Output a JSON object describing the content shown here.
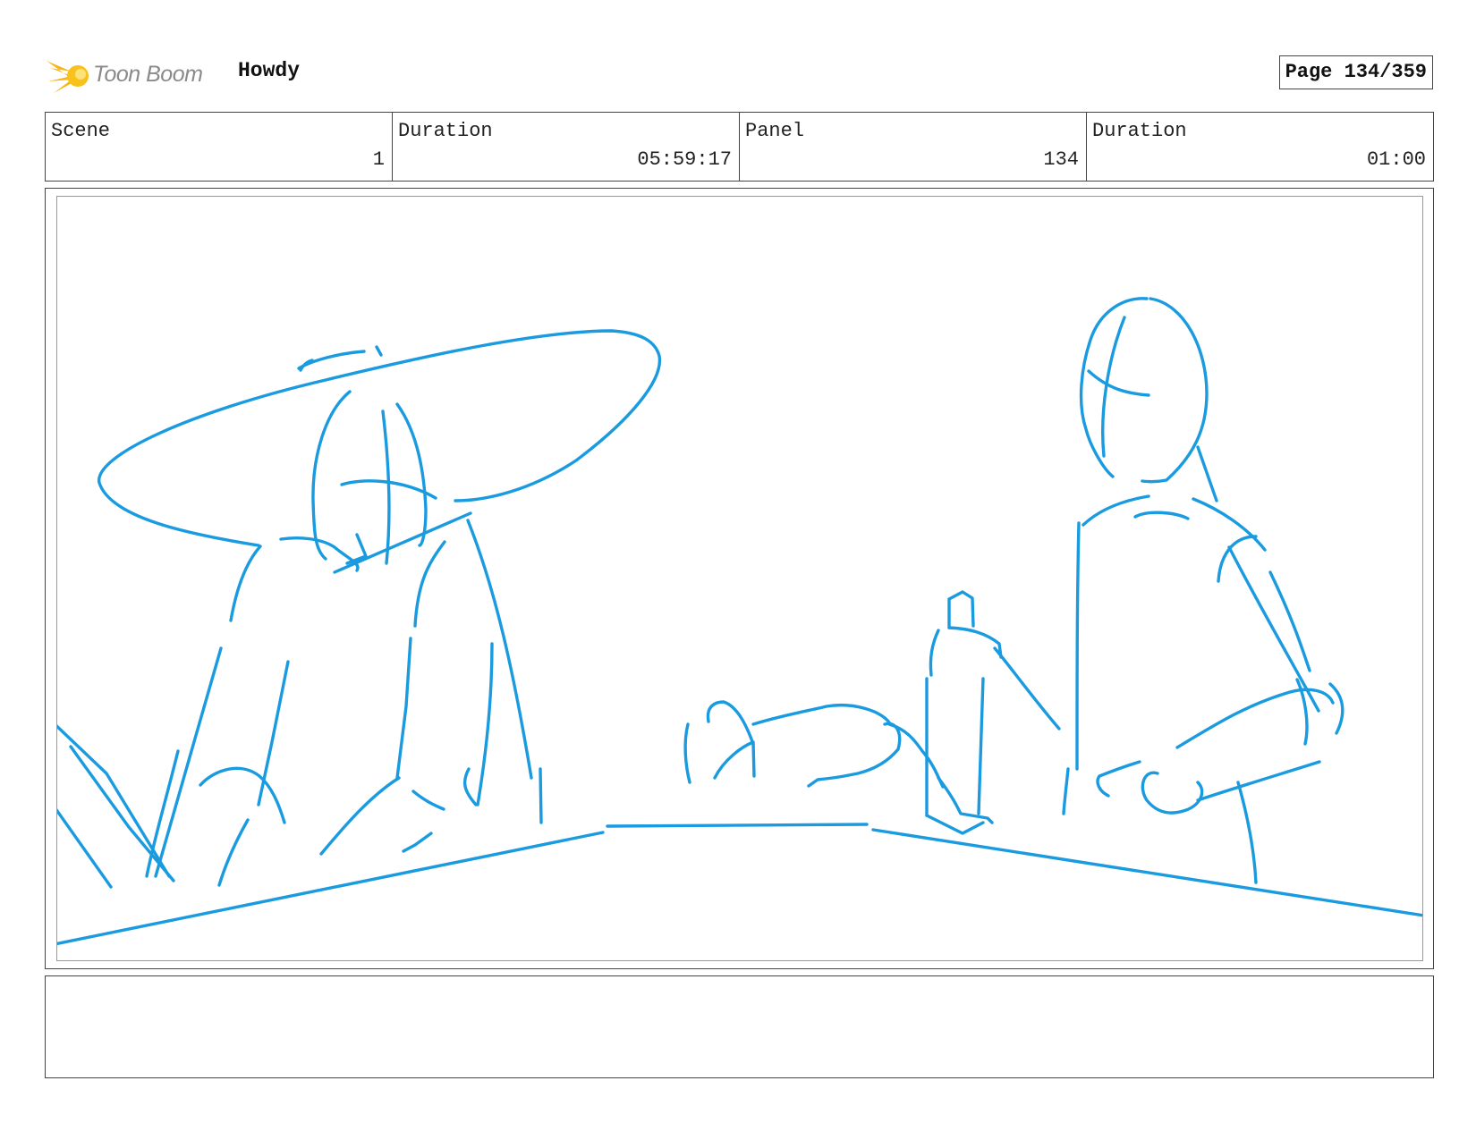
{
  "header": {
    "logo_text": "Toon Boom",
    "logo_icon": "toon-boom-star-icon",
    "project_title": "Howdy",
    "page_label": "Page 134/359"
  },
  "info": {
    "scene_label": "Scene",
    "scene_value": "1",
    "scene_duration_label": "Duration",
    "scene_duration_value": "05:59:17",
    "panel_label": "Panel",
    "panel_value": "134",
    "panel_duration_label": "Duration",
    "panel_duration_value": "01:00"
  },
  "panel": {
    "sketch_color": "#1a9be0",
    "description": ""
  },
  "notes": {
    "text": ""
  }
}
